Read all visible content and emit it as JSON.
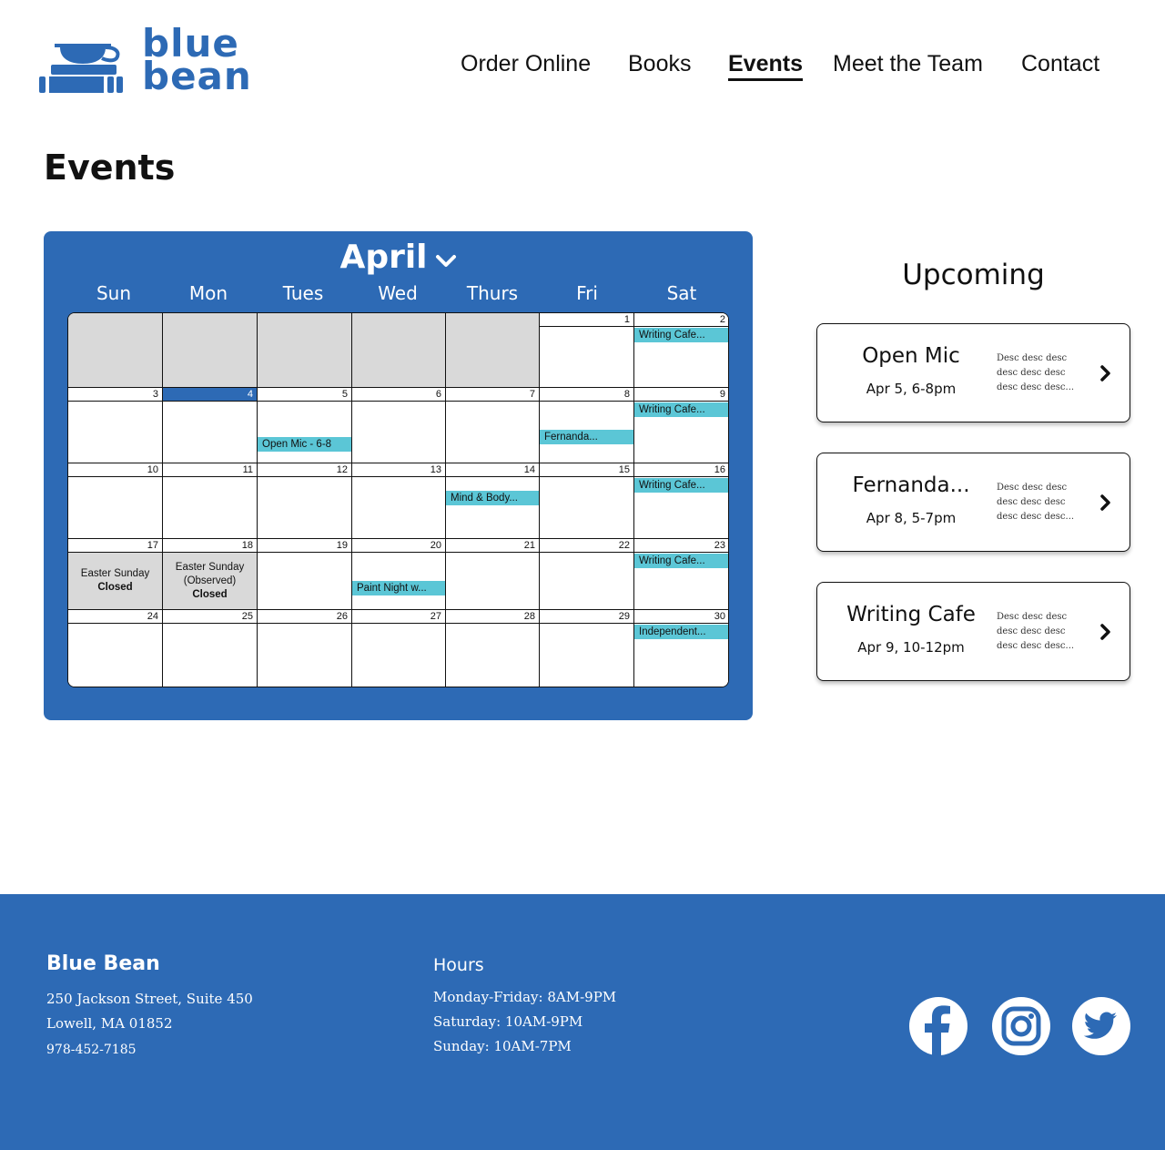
{
  "brand": {
    "logo_line1": "blue",
    "logo_line2": "bean",
    "color": "#2d6ab5"
  },
  "nav": [
    {
      "label": "Order Online",
      "active": false
    },
    {
      "label": "Books",
      "active": false
    },
    {
      "label": "Events",
      "active": true
    },
    {
      "label": "Meet the Team",
      "active": false
    },
    {
      "label": "Contact",
      "active": false
    }
  ],
  "page_title": "Events",
  "calendar": {
    "month": "April",
    "weekdays": [
      "Sun",
      "Mon",
      "Tues",
      "Wed",
      "Thurs",
      "Fri",
      "Sat"
    ],
    "today": 4,
    "leading_empty_days": 5,
    "days": [
      {
        "n": "1"
      },
      {
        "n": "2",
        "event": "Writing Cafe..."
      },
      {
        "n": "3"
      },
      {
        "n": "4"
      },
      {
        "n": "5",
        "event": "Open Mic - 6-8"
      },
      {
        "n": "6"
      },
      {
        "n": "7"
      },
      {
        "n": "8",
        "event": "Fernanda..."
      },
      {
        "n": "9",
        "event": "Writing Cafe..."
      },
      {
        "n": "10"
      },
      {
        "n": "11"
      },
      {
        "n": "12"
      },
      {
        "n": "13"
      },
      {
        "n": "14",
        "event": "Mind & Body..."
      },
      {
        "n": "15"
      },
      {
        "n": "16",
        "event": "Writing Cafe..."
      },
      {
        "n": "17",
        "closed_line1": "Easter Sunday",
        "closed_line2": "",
        "closed_label": "Closed"
      },
      {
        "n": "18",
        "closed_line1": "Easter Sunday",
        "closed_line2": "(Observed)",
        "closed_label": "Closed"
      },
      {
        "n": "19"
      },
      {
        "n": "20",
        "event": "Paint Night w..."
      },
      {
        "n": "21"
      },
      {
        "n": "22"
      },
      {
        "n": "23",
        "event": "Writing Cafe..."
      },
      {
        "n": "24"
      },
      {
        "n": "25"
      },
      {
        "n": "26"
      },
      {
        "n": "27"
      },
      {
        "n": "28"
      },
      {
        "n": "29"
      },
      {
        "n": "30",
        "event": "Independent..."
      }
    ]
  },
  "upcoming": {
    "title": "Upcoming",
    "cards": [
      {
        "title": "Open Mic",
        "date": "Apr 5, 6-8pm",
        "desc": "Desc desc desc desc desc desc desc desc desc..."
      },
      {
        "title": "Fernanda...",
        "date": "Apr 8, 5-7pm",
        "desc": "Desc desc desc desc desc desc desc desc desc..."
      },
      {
        "title": "Writing Cafe",
        "date": "Apr 9, 10-12pm",
        "desc": "Desc desc desc desc desc desc desc desc desc..."
      }
    ]
  },
  "footer": {
    "brand": "Blue Bean",
    "address_line1": "250 Jackson Street, Suite 450",
    "address_line2": "Lowell, MA 01852",
    "phone": "978-452-7185",
    "hours_title": "Hours",
    "hours": [
      "Monday-Friday: 8AM-9PM",
      "Saturday: 10AM-9PM",
      "Sunday: 10AM-7PM"
    ],
    "social_icons": [
      "facebook-icon",
      "instagram-icon",
      "twitter-icon"
    ]
  }
}
